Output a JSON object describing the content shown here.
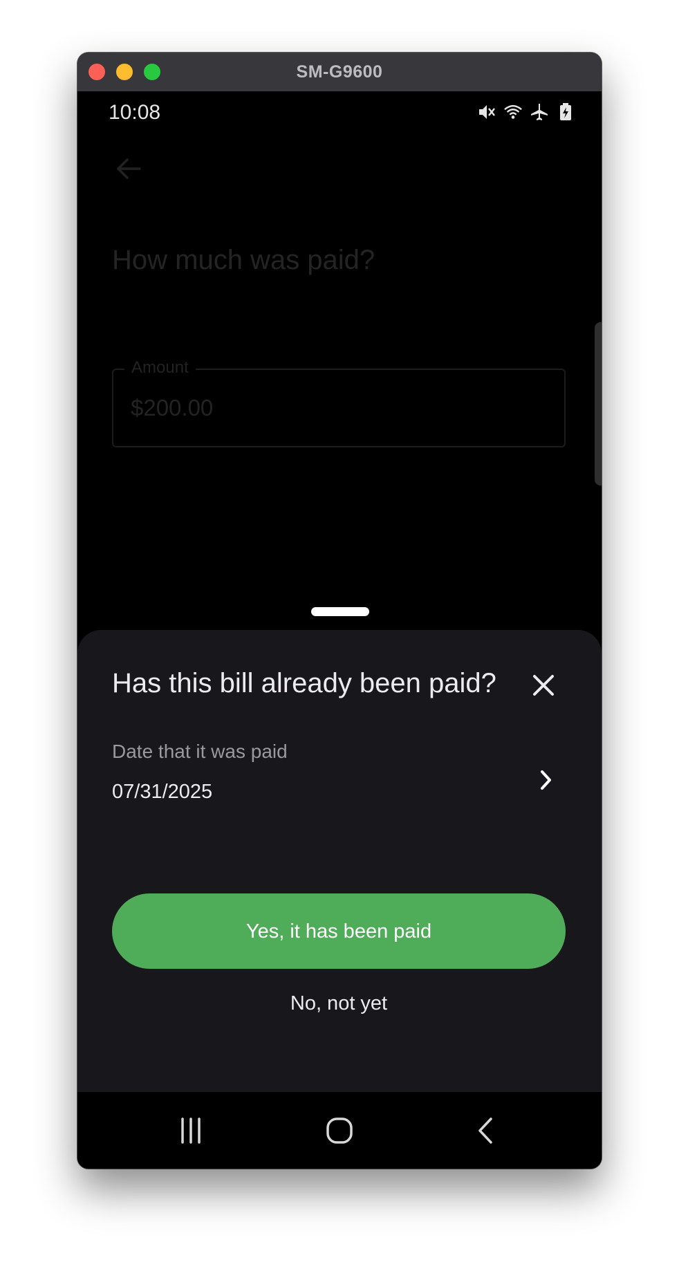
{
  "window": {
    "title": "SM-G9600"
  },
  "status_bar": {
    "time": "10:08",
    "icons": [
      "mute-icon",
      "wifi-icon",
      "airplane-icon",
      "battery-charging-icon"
    ]
  },
  "background_page": {
    "title": "How much was paid?",
    "amount_field": {
      "label": "Amount",
      "value": "$200.00"
    }
  },
  "sheet": {
    "title": "Has this bill already been paid?",
    "date_label": "Date that it was paid",
    "date_value": "07/31/2025",
    "primary_button": "Yes, it has been paid",
    "secondary_button": "No, not yet"
  },
  "colors": {
    "accent_green": "#4fac58",
    "sheet_background": "#18171b",
    "titlebar": "#38373c"
  }
}
